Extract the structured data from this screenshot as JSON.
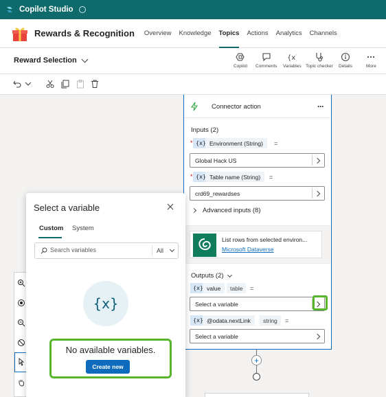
{
  "titlebar": {
    "title": "Copilot Studio"
  },
  "header": {
    "bot_name": "Rewards & Recognition",
    "tabs": [
      {
        "label": "Overview"
      },
      {
        "label": "Knowledge"
      },
      {
        "label": "Topics",
        "active": true
      },
      {
        "label": "Actions"
      },
      {
        "label": "Analytics"
      },
      {
        "label": "Channels"
      }
    ]
  },
  "topic": {
    "name": "Reward Selection",
    "tools": [
      {
        "label": "Copilot",
        "icon": "copilot-icon"
      },
      {
        "label": "Comments",
        "icon": "comment-icon"
      },
      {
        "label": "Variables",
        "icon": "variable-icon"
      },
      {
        "label": "Topic checker",
        "icon": "stethoscope-icon"
      },
      {
        "label": "Details",
        "icon": "info-icon"
      },
      {
        "label": "More",
        "icon": "more-icon"
      }
    ]
  },
  "edit_toolbar": {
    "icons": [
      "undo-icon",
      "chevron-down-icon",
      "cut-icon",
      "copy-icon",
      "paste-icon",
      "delete-icon"
    ]
  },
  "variable_panel": {
    "title": "Select a variable",
    "tabs": [
      {
        "label": "Custom",
        "active": true
      },
      {
        "label": "System"
      }
    ],
    "search_placeholder": "Search variables",
    "filter_value": "All",
    "empty_icon_text": "{x}",
    "empty_text": "No available variables.",
    "create_button": "Create new"
  },
  "node": {
    "title": "Connector action",
    "more": "···",
    "inputs_label": "Inputs (2)",
    "var_chip": "{x}",
    "equals": "=",
    "inputs": [
      {
        "name": "Environment (String)",
        "value": "Global Hack US",
        "required": "*"
      },
      {
        "name": "Table name (String)",
        "value": "crd69_rewardses",
        "required": "*"
      }
    ],
    "advanced_inputs": "Advanced inputs (8)",
    "connector": {
      "description": "List rows from selected environ...",
      "link": "Microsoft Dataverse"
    },
    "outputs_label": "Outputs (2)",
    "outputs": [
      {
        "name": "value",
        "type": "table",
        "placeholder": "Select a variable"
      },
      {
        "name": "@odata.nextLink",
        "type": "string",
        "placeholder": "Select a variable"
      }
    ]
  },
  "flow": {
    "add_label": "+"
  },
  "colors": {
    "brand": "#0f6b6b",
    "accent": "#0f6cbd",
    "highlight": "#57b52b",
    "required": "#c50f1f"
  }
}
